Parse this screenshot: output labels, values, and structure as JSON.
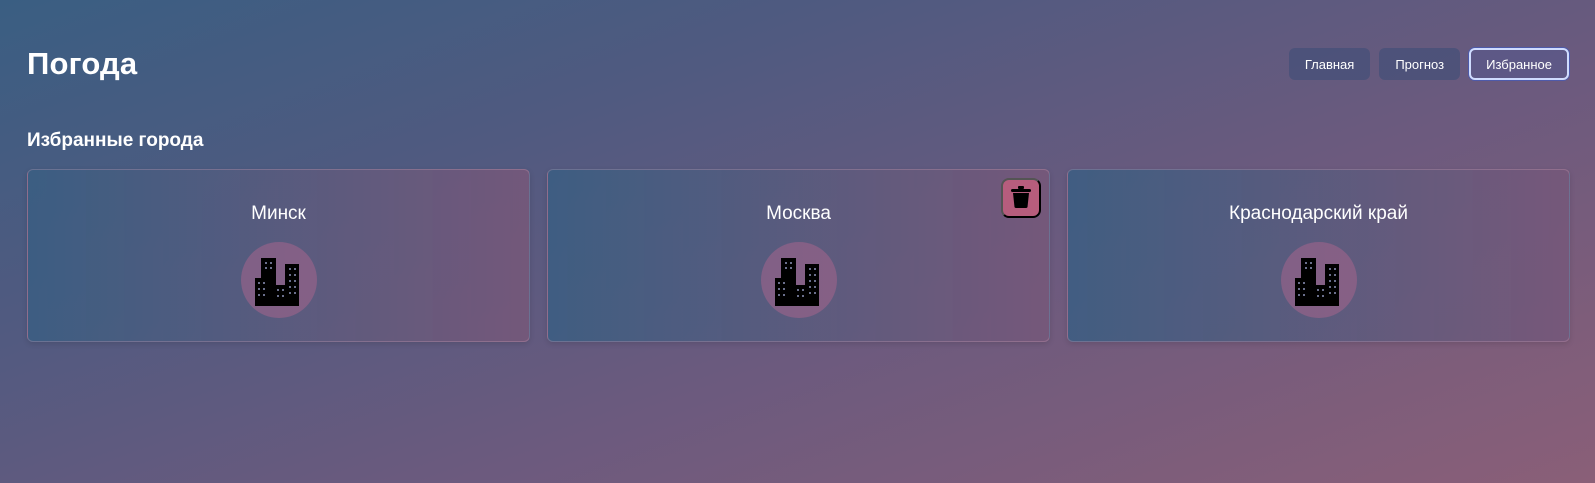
{
  "header": {
    "title": "Погода",
    "nav": [
      {
        "label": "Главная",
        "active": false
      },
      {
        "label": "Прогноз",
        "active": false
      },
      {
        "label": "Избранное",
        "active": true
      }
    ]
  },
  "favorites": {
    "title": "Избранные города",
    "cities": [
      {
        "name": "Минск",
        "icon": "city-buildings-icon"
      },
      {
        "name": "Москва",
        "icon": "city-buildings-icon",
        "delete_icon": "trash-icon"
      },
      {
        "name": "Краснодарский край",
        "icon": "city-buildings-icon"
      }
    ]
  },
  "colors": {
    "background_start": "#3a5e82",
    "background_end": "#8a5f78",
    "active_border": "#cfdcff",
    "delete_button": "#cd5f7d"
  }
}
